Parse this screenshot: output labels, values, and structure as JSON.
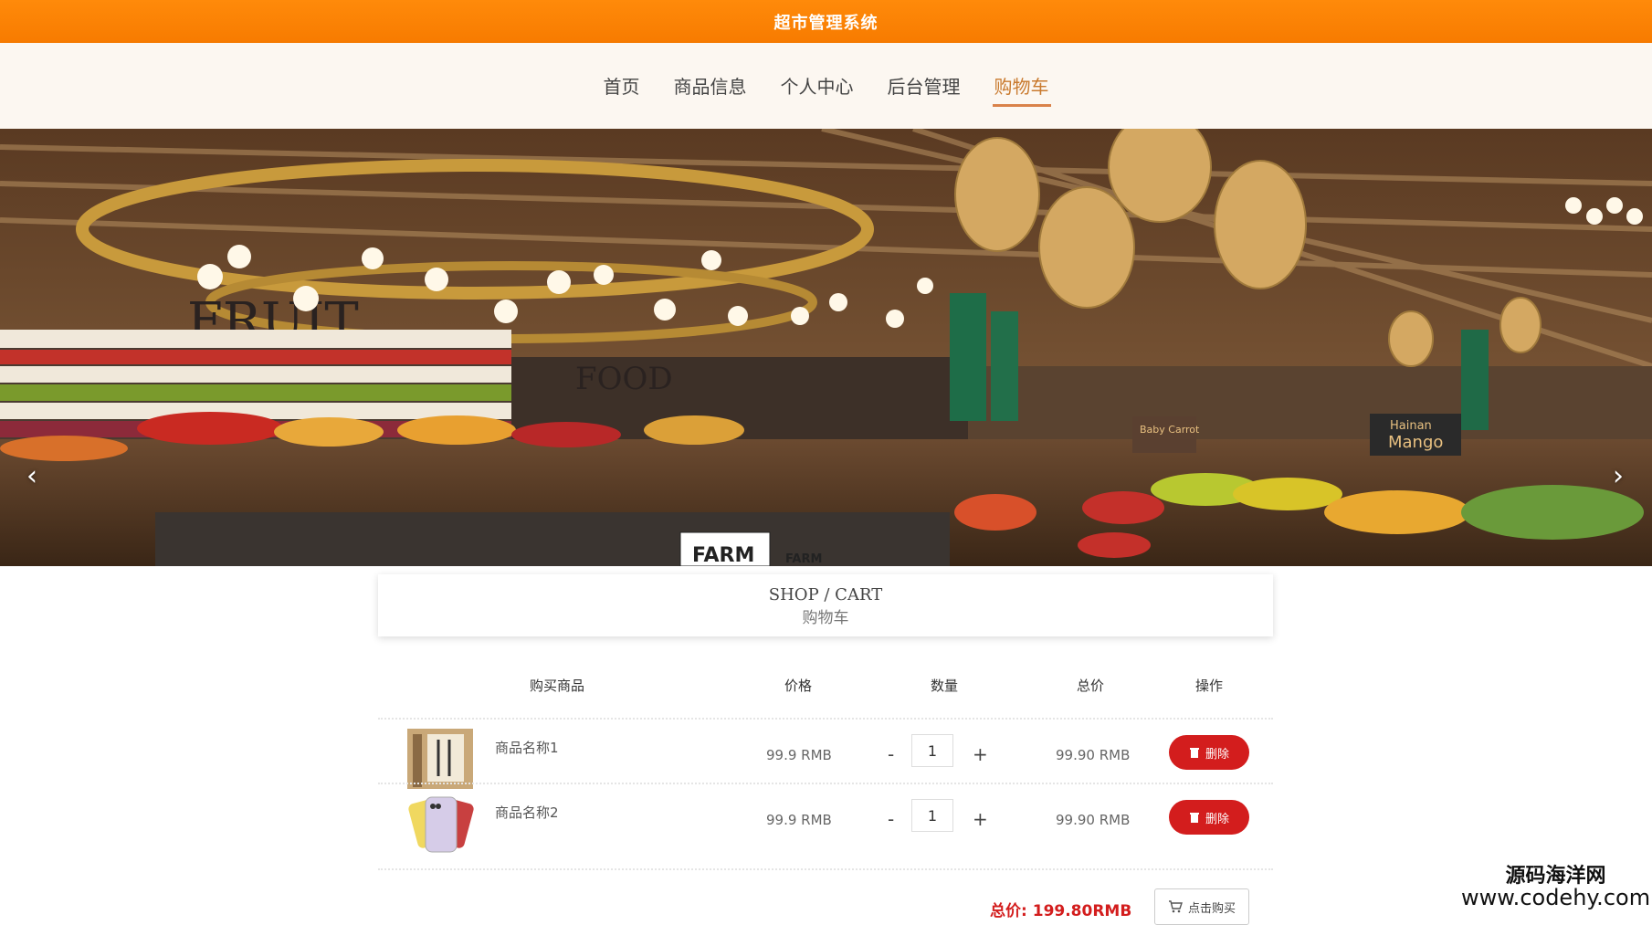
{
  "app": {
    "title": "超市管理系统"
  },
  "nav": {
    "items": [
      {
        "label": "首页",
        "active": false
      },
      {
        "label": "商品信息",
        "active": false
      },
      {
        "label": "个人中心",
        "active": false
      },
      {
        "label": "后台管理",
        "active": false
      },
      {
        "label": "购物车",
        "active": true
      }
    ]
  },
  "banner": {
    "prev_icon": "chevron-left-icon",
    "next_icon": "chevron-right-icon",
    "signs": {
      "fruit": "FRUIT",
      "food": "FOOD",
      "farm": "FARM",
      "farm_small": "FARM",
      "mango_brand": "Hainan",
      "mango": "Mango",
      "carrot": "Baby Carrot"
    }
  },
  "section": {
    "en": "SHOP / CART",
    "cn": "购物车"
  },
  "cart": {
    "headers": {
      "product": "购买商品",
      "price": "价格",
      "quantity": "数量",
      "total": "总价",
      "action": "操作"
    },
    "items": [
      {
        "name": "商品名称1",
        "price": "99.9 RMB",
        "quantity": "1",
        "subtotal": "99.90 RMB",
        "minus": "-",
        "plus": "+",
        "delete_label": "删除"
      },
      {
        "name": "商品名称2",
        "price": "99.9 RMB",
        "quantity": "1",
        "subtotal": "99.90 RMB",
        "minus": "-",
        "plus": "+",
        "delete_label": "删除"
      }
    ],
    "total_label": "总价:",
    "total_value": "199.80RMB",
    "buy_label": "点击购买"
  },
  "watermark": {
    "line1": "源码海洋网",
    "line2": "www.codehy.com"
  },
  "colors": {
    "topbar": "#f77b00",
    "accent": "#d31d1d",
    "nav_active": "#c97a2e"
  }
}
